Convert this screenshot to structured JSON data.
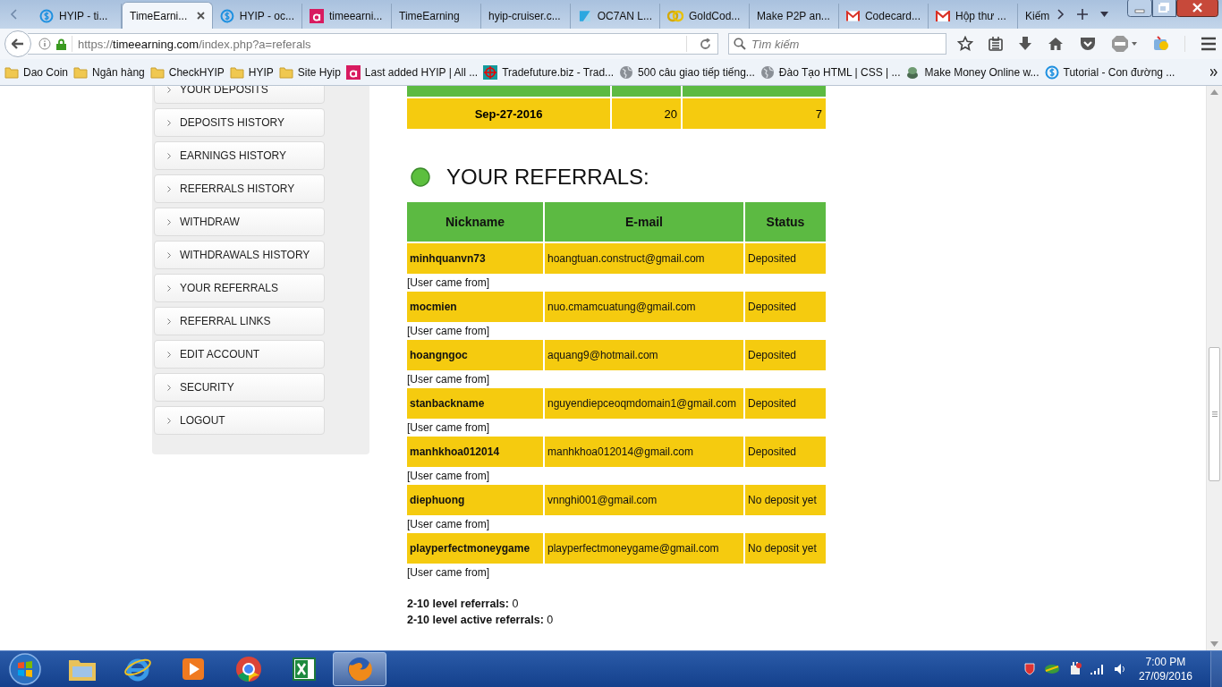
{
  "browser": {
    "tabs": [
      {
        "label": "HYIP - ti...",
        "kind": "dollar",
        "selected": false
      },
      {
        "label": "TimeEarni...",
        "kind": "none",
        "selected": true
      },
      {
        "label": "HYIP - oc...",
        "kind": "dollar",
        "selected": false
      },
      {
        "label": "timeearni...",
        "kind": "letter",
        "selected": false
      },
      {
        "label": "TimeEarning",
        "kind": "none",
        "selected": false
      },
      {
        "label": "hyip-cruiser.c...",
        "kind": "none",
        "selected": false
      },
      {
        "label": "OC7AN L...",
        "kind": "arrow",
        "selected": false
      },
      {
        "label": "GoldCod...",
        "kind": "coins",
        "selected": false
      },
      {
        "label": "Make P2P an...",
        "kind": "none",
        "selected": false
      },
      {
        "label": "Codecard...",
        "kind": "mail",
        "selected": false
      },
      {
        "label": "Hộp thư ...",
        "kind": "mail",
        "selected": false
      },
      {
        "label": "Kiếm",
        "kind": "none",
        "selected": false
      }
    ],
    "address": {
      "scheme": "https://",
      "host": "timeearning.com",
      "path": "/index.php?a=referals"
    },
    "search": {
      "placeholder": "Tìm kiếm"
    },
    "bookmarks": [
      {
        "label": "Dao Coin",
        "kind": "folder"
      },
      {
        "label": "Ngân hàng",
        "kind": "folder"
      },
      {
        "label": "CheckHYIP",
        "kind": "folder"
      },
      {
        "label": "HYIP",
        "kind": "folder"
      },
      {
        "label": "Site Hyip",
        "kind": "folder"
      },
      {
        "label": "Last added HYIP | All ...",
        "kind": "letter"
      },
      {
        "label": "Tradefuture.biz - Trad...",
        "kind": "target"
      },
      {
        "label": "500 câu giao tiếp tiếng...",
        "kind": "globe"
      },
      {
        "label": "Đào Tạo HTML | CSS | ...",
        "kind": "globe"
      },
      {
        "label": "Make Money Online w...",
        "kind": "coin"
      },
      {
        "label": "Tutorial - Con đường ...",
        "kind": "dollar"
      }
    ]
  },
  "sidebar": {
    "items": [
      "YOUR DEPOSITS",
      "DEPOSITS HISTORY",
      "EARNINGS HISTORY",
      "REFERRALS HISTORY",
      "WITHDRAW",
      "WITHDRAWALS HISTORY",
      "YOUR REFERRALS",
      "REFERRAL LINKS",
      "EDIT ACCOUNT",
      "SECURITY",
      "LOGOUT"
    ]
  },
  "deposits_table": {
    "rows": [
      {
        "column_1": "Sep-27-2016",
        "column_2": "20",
        "column_3": "7"
      }
    ]
  },
  "referrals": {
    "title": "YOUR REFERRALS:",
    "columns": [
      "Nickname",
      "E-mail",
      "Status"
    ],
    "rows": [
      {
        "nickname": "minhquanvn73",
        "email": "hoangtuan.construct@gmail.com",
        "status": "Deposited",
        "note": "[User came from]"
      },
      {
        "nickname": "mocmien",
        "email": "nuo.cmamcuatung@gmail.com",
        "status": "Deposited",
        "note": "[User came from]"
      },
      {
        "nickname": "hoangngoc",
        "email": "aquang9@hotmail.com",
        "status": "Deposited",
        "note": "[User came from]"
      },
      {
        "nickname": "stanbackname",
        "email": "nguyendiepceoqmdomain1@gmail.com",
        "status": "Deposited",
        "note": "[User came from]"
      },
      {
        "nickname": "manhkhoa012014",
        "email": "manhkhoa012014@gmail.com",
        "status": "Deposited",
        "note": "[User came from]"
      },
      {
        "nickname": "diephuong",
        "email": "vnnghi001@gmail.com",
        "status": "No deposit yet",
        "note": "[User came from]"
      },
      {
        "nickname": "playperfectmoneygame",
        "email": "playperfectmoneygame@gmail.com",
        "status": "No deposit yet",
        "note": "[User came from]"
      }
    ]
  },
  "summary": [
    {
      "label": "2-10 level referrals:",
      "value": "0"
    },
    {
      "label": "2-10 level active referrals:",
      "value": "0"
    }
  ],
  "taskbar": {
    "apps": [
      {
        "kind": "folder",
        "selected": false
      },
      {
        "kind": "ie",
        "selected": false
      },
      {
        "kind": "media",
        "selected": false
      },
      {
        "kind": "chrome",
        "selected": false
      },
      {
        "kind": "excel",
        "selected": false
      },
      {
        "kind": "firefox",
        "selected": true
      }
    ],
    "time": "7:00 PM",
    "date": "27/09/2016"
  }
}
